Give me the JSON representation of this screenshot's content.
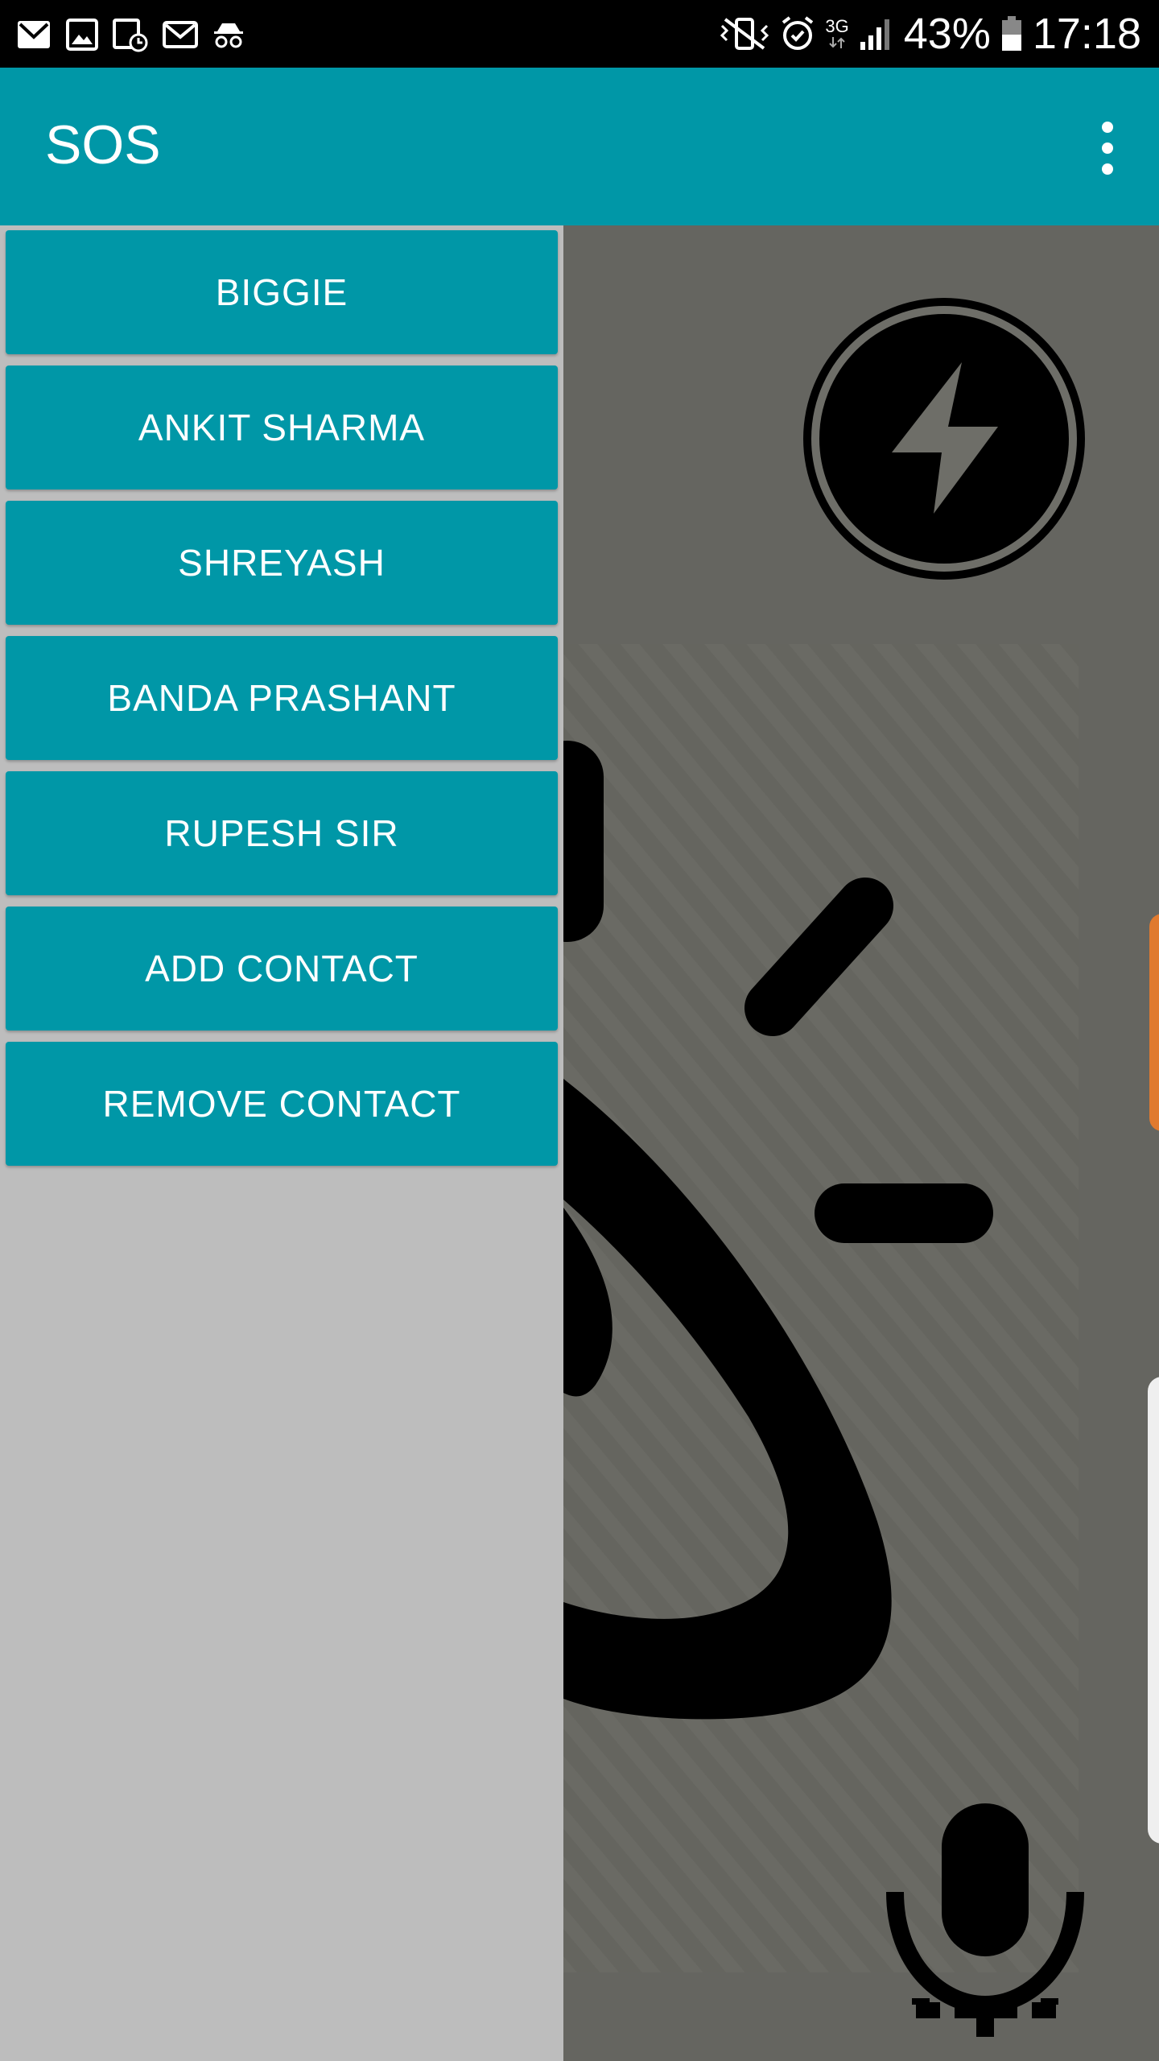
{
  "status_bar": {
    "icons_left": [
      "gmail-icon",
      "gallery-icon",
      "calendar-icon",
      "email-icon",
      "incognito-icon"
    ],
    "icons_right": [
      "vibrate-icon",
      "alarm-icon",
      "network-3g-icon",
      "signal-icon",
      "battery-icon"
    ],
    "network": "3G",
    "battery": "43%",
    "time": "17:18"
  },
  "app_bar": {
    "title": "SOS",
    "menu_icon": "overflow-menu-icon"
  },
  "drawer": {
    "buttons": [
      {
        "label": "BIGGIE"
      },
      {
        "label": "ANKIT SHARMA"
      },
      {
        "label": "SHREYASH"
      },
      {
        "label": "BANDA PRASHANT"
      },
      {
        "label": "RUPESH SIR"
      },
      {
        "label": "ADD CONTACT"
      },
      {
        "label": "REMOVE CONTACT"
      }
    ]
  },
  "main": {
    "flash_icon": "flash-icon",
    "alarm_illustration": "alarm-light-icon",
    "mic_icon": "microphone-icon"
  },
  "colors": {
    "primary": "#0097a7",
    "drawer_bg": "#bdbdbd",
    "pane_bg": "#656560",
    "accent_orange": "#e07a2f"
  }
}
